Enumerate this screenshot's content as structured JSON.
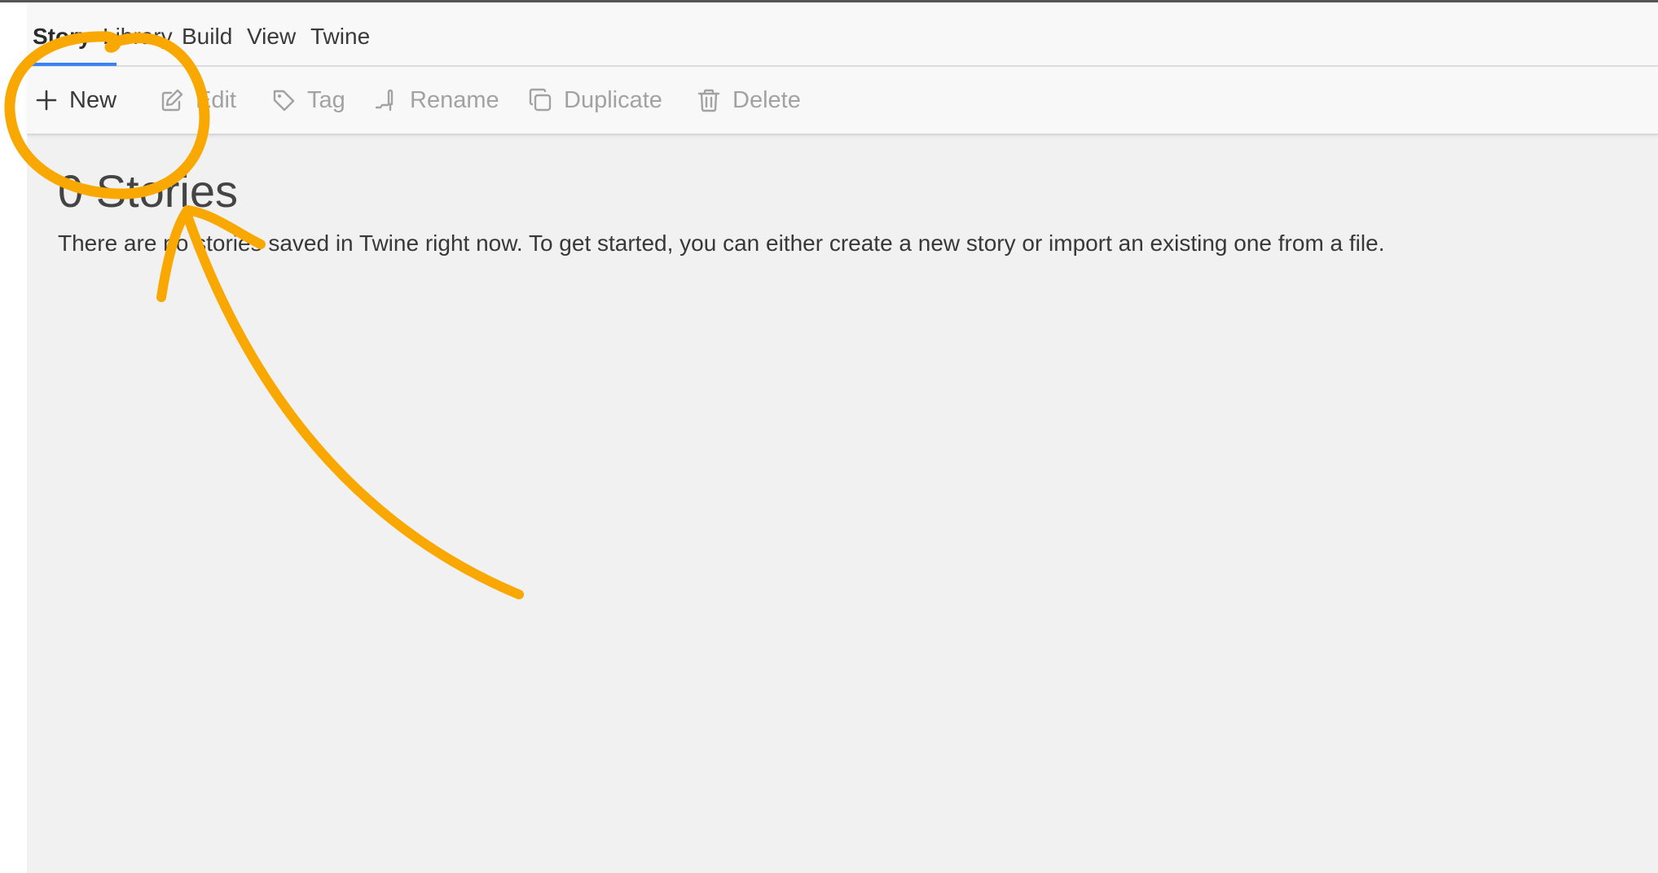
{
  "menubar": {
    "tabs": [
      {
        "label": "Story",
        "active": true
      },
      {
        "label": "Library",
        "active": false
      },
      {
        "label": "Build",
        "active": false
      },
      {
        "label": "View",
        "active": false
      },
      {
        "label": "Twine",
        "active": false
      }
    ]
  },
  "toolbar": {
    "buttons": [
      {
        "label": "New",
        "icon": "plus-icon",
        "enabled": true
      },
      {
        "label": "Edit",
        "icon": "pencil-icon",
        "enabled": false
      },
      {
        "label": "Tag",
        "icon": "tag-icon",
        "enabled": false
      },
      {
        "label": "Rename",
        "icon": "rename-icon",
        "enabled": false
      },
      {
        "label": "Duplicate",
        "icon": "duplicate-icon",
        "enabled": false
      },
      {
        "label": "Delete",
        "icon": "trash-icon",
        "enabled": false
      }
    ]
  },
  "main": {
    "title": "0 Stories",
    "message": "There are no stories saved in Twine right now. To get started, you can either create a new story or import an existing one from a file."
  },
  "colors": {
    "accent": "#3b82f6",
    "annotation": "#f8a800",
    "background": "#f1f1f1",
    "menubar": "#f8f8f8"
  }
}
